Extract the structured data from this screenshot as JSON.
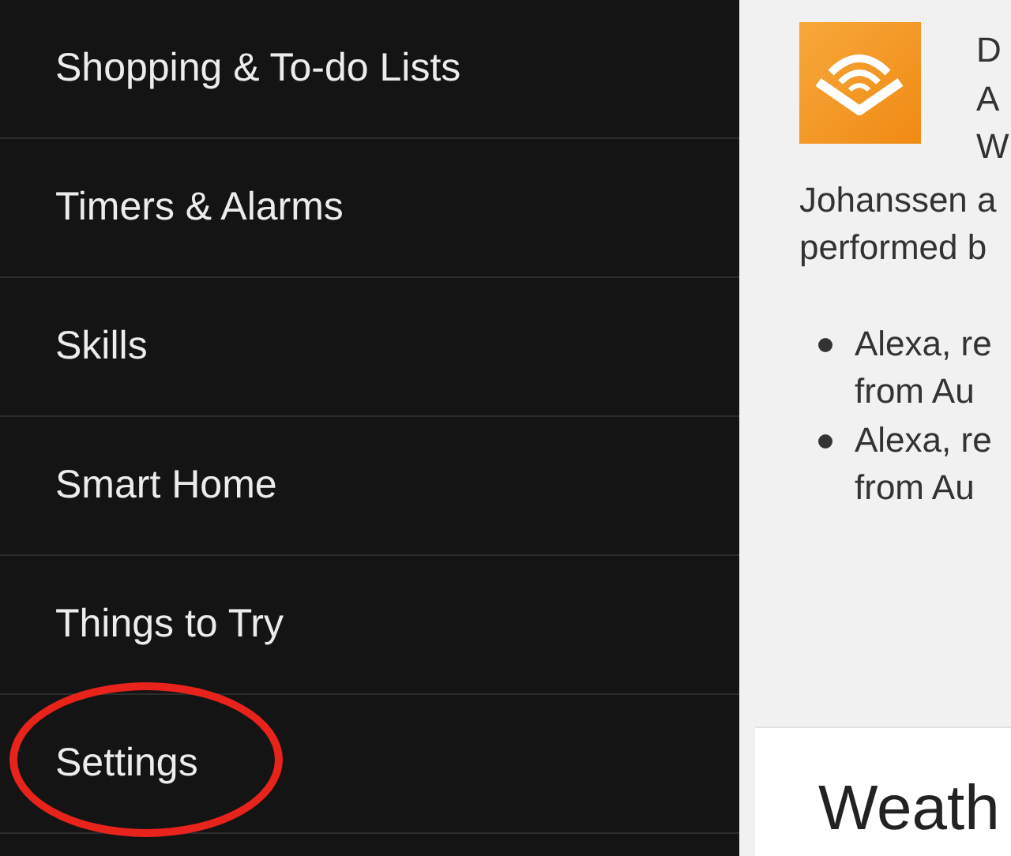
{
  "menu": {
    "items": [
      {
        "label": "Shopping & To-do Lists",
        "circled": false
      },
      {
        "label": "Timers & Alarms",
        "circled": false
      },
      {
        "label": "Skills",
        "circled": false
      },
      {
        "label": "Smart Home",
        "circled": false
      },
      {
        "label": "Things to Try",
        "circled": false
      },
      {
        "label": "Settings",
        "circled": true
      }
    ]
  },
  "content": {
    "intro_side_lines": [
      "D",
      "A",
      "W"
    ],
    "intro_lines": [
      "Johanssen a",
      "performed b"
    ],
    "bullets": [
      {
        "lines": [
          "Alexa, re",
          "from Au"
        ]
      },
      {
        "lines": [
          "Alexa, re",
          "from Au"
        ]
      }
    ],
    "card": {
      "title": "Weath"
    }
  }
}
